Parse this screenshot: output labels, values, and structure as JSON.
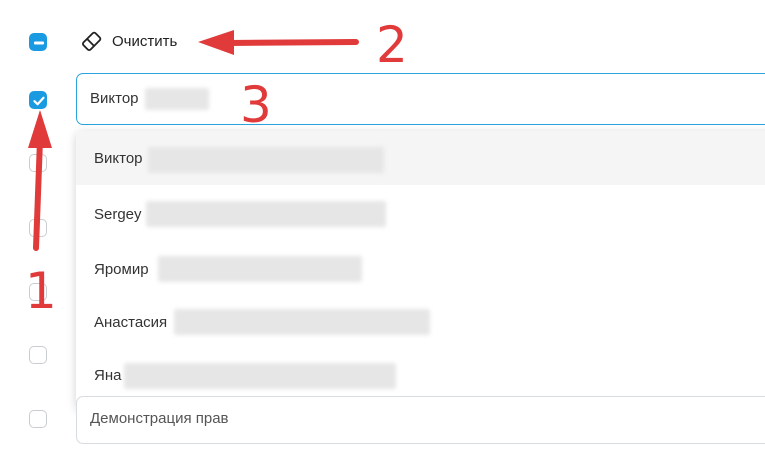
{
  "toolbar": {
    "clear_label": "Очистить"
  },
  "search": {
    "value": "Виктор"
  },
  "dropdown": {
    "options": [
      {
        "name": "Виктор"
      },
      {
        "name": "Sergey"
      },
      {
        "name": "Яромир"
      },
      {
        "name": "Анастасия"
      },
      {
        "name": "Яна"
      }
    ]
  },
  "bottom_field": {
    "value": "Демонстрация прав"
  },
  "annotations": {
    "a1": "1",
    "a2": "2",
    "a3": "3"
  },
  "colors": {
    "accent": "#1a9ae0",
    "annotation": "#e03a3a"
  },
  "icons": {
    "clear": "eraser-icon",
    "select_all": "minus-checkbox-icon",
    "checked": "checkmark-icon"
  }
}
